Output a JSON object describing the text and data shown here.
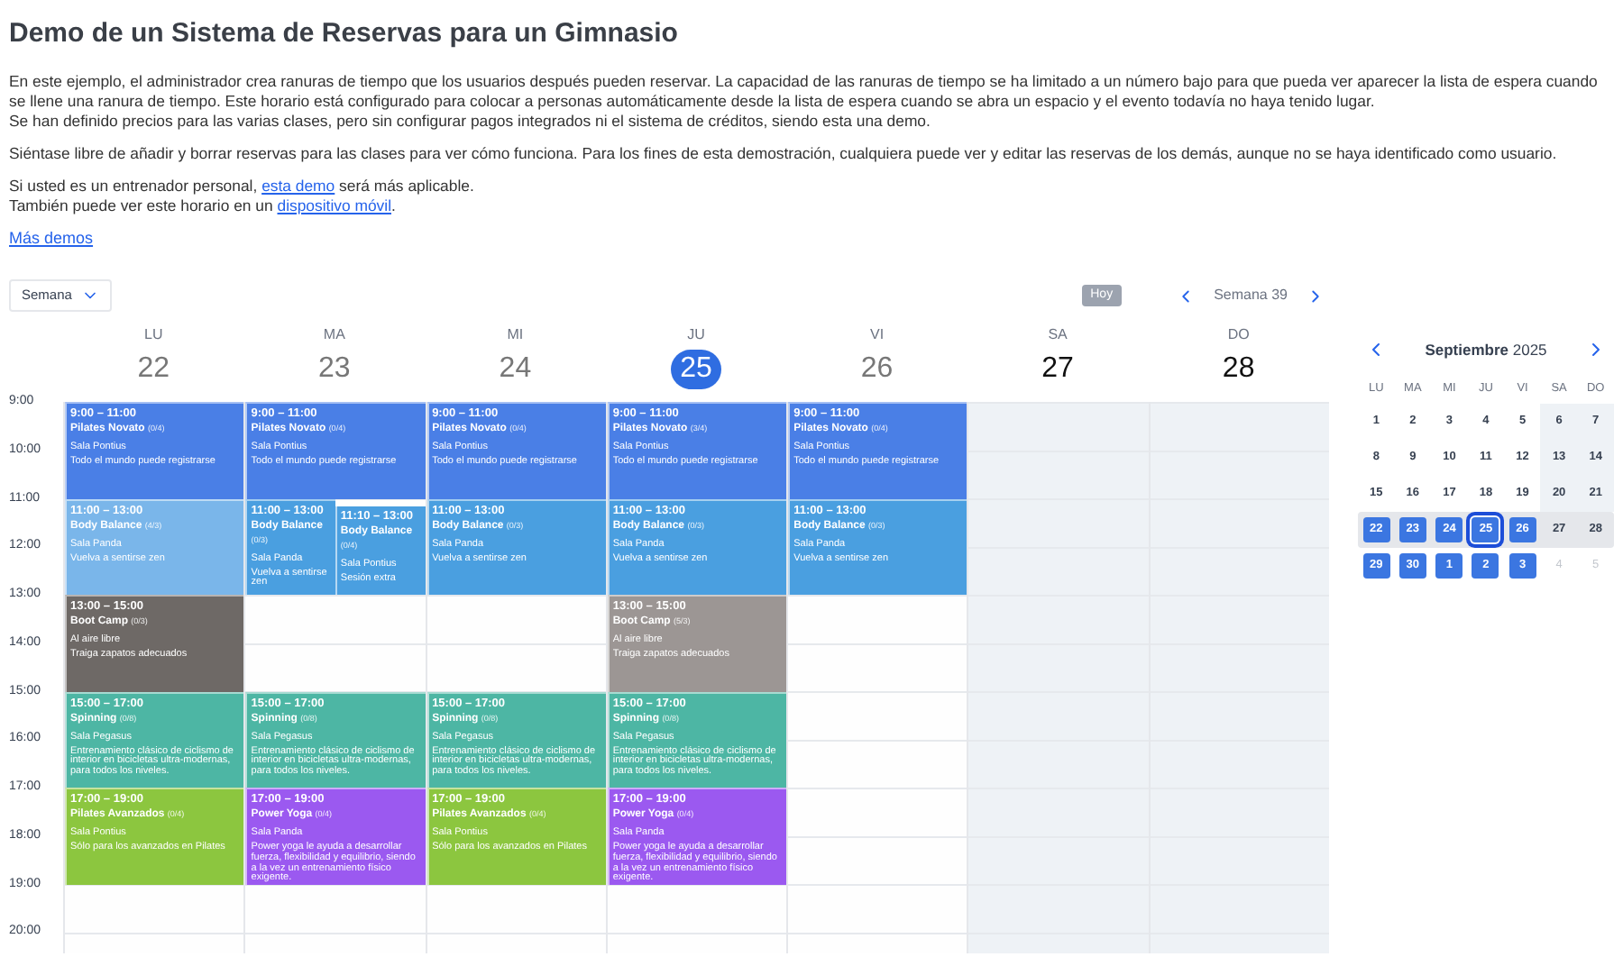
{
  "title": "Demo de un Sistema de Reservas para un Gimnasio",
  "paragraphs": [
    {
      "lines": [
        [
          {
            "text": "En este ejemplo, el administrador crea ranuras de tiempo que los usuarios después pueden reservar. La capacidad de las ranuras de tiempo se ha limitado a un número bajo para que pueda ver aparecer la lista de espera cuando se llene una ranura de tiempo. Este horario está configurado para colocar a personas automáticamente desde la lista de espera cuando se abra un espacio y el evento todavía no haya tenido lugar."
          }
        ],
        [
          {
            "text": "Se han definido precios para las varias clases, pero sin configurar pagos integrados ni el sistema de créditos, siendo esta una demo."
          }
        ]
      ]
    },
    {
      "lines": [
        [
          {
            "text": "Siéntase libre de añadir y borrar reservas para las clases para ver cómo funciona. Para los fines de esta demostración, cualquiera puede ver y editar las reservas de los demás, aunque no se haya identificado como usuario."
          }
        ]
      ]
    },
    {
      "lines": [
        [
          {
            "text": "Si usted es un entrenador personal, "
          },
          {
            "text": "esta demo",
            "kind": "link"
          },
          {
            "text": " será más aplicable."
          }
        ],
        [
          {
            "text": "También puede ver este horario en un "
          },
          {
            "text": "dispositivo móvil",
            "kind": "link"
          },
          {
            "text": "."
          }
        ]
      ]
    }
  ],
  "more_link": "Más demos",
  "toolbar": {
    "view_select": "Semana",
    "today_button": "Hoy",
    "week_label": "Semana 39"
  },
  "hours": [
    "9:00",
    "10:00",
    "11:00",
    "12:00",
    "13:00",
    "14:00",
    "15:00",
    "16:00",
    "17:00",
    "18:00",
    "19:00",
    "20:00"
  ],
  "days": [
    {
      "weekday": "LU",
      "date": "22",
      "selected": false,
      "weekend": false,
      "events": [
        {
          "time": "9:00 – 11:00",
          "title": "Pilates Novato",
          "count": "(0/4)",
          "room": "Sala Pontius",
          "description": "Todo el mundo puede registrarse",
          "color": "#4a7fe6"
        },
        {
          "time": "11:00 – 13:00",
          "title": "Body Balance",
          "count": "(4/3)",
          "room": "Sala Panda",
          "description": "Vuelva a sentirse zen",
          "color": "#7ab6ea"
        },
        {
          "time": "13:00 – 15:00",
          "title": "Boot Camp",
          "count": "(0/3)",
          "room": "Al aire libre",
          "description": "Traiga zapatos adecuados",
          "color": "#6e6966"
        },
        {
          "time": "15:00 – 17:00",
          "title": "Spinning",
          "count": "(0/8)",
          "room": "Sala Pegasus",
          "description": "Entrenamiento clásico de ciclismo de interior en bicicletas ultra-modernas, para todos los niveles.",
          "color": "#4db6a4"
        },
        {
          "time": "17:00 – 19:00",
          "title": "Pilates Avanzados",
          "count": "(0/4)",
          "room": "Sala Pontius",
          "description": "Sólo para los avanzados en Pilates",
          "color": "#8cc63f"
        }
      ]
    },
    {
      "weekday": "MA",
      "date": "23",
      "selected": false,
      "weekend": false,
      "events": [
        {
          "time": "9:00 – 11:00",
          "title": "Pilates Novato",
          "count": "(0/4)",
          "room": "Sala Pontius",
          "description": "Todo el mundo puede registrarse",
          "color": "#4a7fe6"
        },
        {
          "time": "11:00 – 13:00",
          "title": "Body Balance",
          "count": "(0/3)",
          "room": "Sala Panda",
          "description": "Vuelva a sentirse zen",
          "color": "#4a9fe0"
        },
        {
          "time": "11:10 – 13:00",
          "title": "Body Balance",
          "count": "(0/4)",
          "room": "Sala Pontius",
          "description": "Sesión extra",
          "color": "#4a9fe0"
        },
        {
          "time": "15:00 – 17:00",
          "title": "Spinning",
          "count": "(0/8)",
          "room": "Sala Pegasus",
          "description": "Entrenamiento clásico de ciclismo de interior en bicicletas ultra-modernas, para todos los niveles.",
          "color": "#4db6a4"
        },
        {
          "time": "17:00 – 19:00",
          "title": "Power Yoga",
          "count": "(0/4)",
          "room": "Sala Panda",
          "description": "Power yoga le ayuda a desarrollar fuerza, flexibilidad y equilibrio, siendo a la vez un entrenamiento físico exigente.",
          "color": "#9b59f0"
        }
      ]
    },
    {
      "weekday": "MI",
      "date": "24",
      "selected": false,
      "weekend": false,
      "events": [
        {
          "time": "9:00 – 11:00",
          "title": "Pilates Novato",
          "count": "(0/4)",
          "room": "Sala Pontius",
          "description": "Todo el mundo puede registrarse",
          "color": "#4a7fe6"
        },
        {
          "time": "11:00 – 13:00",
          "title": "Body Balance",
          "count": "(0/3)",
          "room": "Sala Panda",
          "description": "Vuelva a sentirse zen",
          "color": "#4a9fe0"
        },
        {
          "time": "15:00 – 17:00",
          "title": "Spinning",
          "count": "(0/8)",
          "room": "Sala Pegasus",
          "description": "Entrenamiento clásico de ciclismo de interior en bicicletas ultra-modernas, para todos los niveles.",
          "color": "#4db6a4"
        },
        {
          "time": "17:00 – 19:00",
          "title": "Pilates Avanzados",
          "count": "(0/4)",
          "room": "Sala Pontius",
          "description": "Sólo para los avanzados en Pilates",
          "color": "#8cc63f"
        }
      ]
    },
    {
      "weekday": "JU",
      "date": "25",
      "selected": true,
      "weekend": false,
      "events": [
        {
          "time": "9:00 – 11:00",
          "title": "Pilates Novato",
          "count": "(3/4)",
          "room": "Sala Pontius",
          "description": "Todo el mundo puede registrarse",
          "color": "#4a7fe6"
        },
        {
          "time": "11:00 – 13:00",
          "title": "Body Balance",
          "count": "(0/3)",
          "room": "Sala Panda",
          "description": "Vuelva a sentirse zen",
          "color": "#4a9fe0"
        },
        {
          "time": "13:00 – 15:00",
          "title": "Boot Camp",
          "count": "(5/3)",
          "room": "Al aire libre",
          "description": "Traiga zapatos adecuados",
          "color": "#9c9694"
        },
        {
          "time": "15:00 – 17:00",
          "title": "Spinning",
          "count": "(0/8)",
          "room": "Sala Pegasus",
          "description": "Entrenamiento clásico de ciclismo de interior en bicicletas ultra-modernas, para todos los niveles.",
          "color": "#4db6a4"
        },
        {
          "time": "17:00 – 19:00",
          "title": "Power Yoga",
          "count": "(0/4)",
          "room": "Sala Panda",
          "description": "Power yoga le ayuda a desarrollar fuerza, flexibilidad y equilibrio, siendo a la vez un entrenamiento físico exigente.",
          "color": "#9b59f0"
        }
      ]
    },
    {
      "weekday": "VI",
      "date": "26",
      "selected": false,
      "weekend": false,
      "events": [
        {
          "time": "9:00 – 11:00",
          "title": "Pilates Novato",
          "count": "(0/4)",
          "room": "Sala Pontius",
          "description": "Todo el mundo puede registrarse",
          "color": "#4a7fe6"
        },
        {
          "time": "11:00 – 13:00",
          "title": "Body Balance",
          "count": "(0/3)",
          "room": "Sala Panda",
          "description": "Vuelva a sentirse zen",
          "color": "#4a9fe0"
        }
      ]
    },
    {
      "weekday": "SA",
      "date": "27",
      "selected": false,
      "weekend": true
    },
    {
      "weekday": "DO",
      "date": "28",
      "selected": false,
      "weekend": true
    }
  ],
  "mini_calendar": {
    "month": "Septiembre",
    "year": "2025",
    "weekdays": [
      "LU",
      "MA",
      "MI",
      "JU",
      "VI",
      "SA",
      "DO"
    ],
    "weeks": [
      {
        "selected": false,
        "days": [
          {
            "label": "1",
            "selected": false,
            "today": false,
            "muted": false
          },
          {
            "label": "2",
            "selected": false,
            "today": false,
            "muted": false
          },
          {
            "label": "3",
            "selected": false,
            "today": false,
            "muted": false
          },
          {
            "label": "4",
            "selected": false,
            "today": false,
            "muted": false
          },
          {
            "label": "5",
            "selected": false,
            "today": false,
            "muted": false
          },
          {
            "label": "6",
            "selected": false,
            "today": false,
            "muted": false
          },
          {
            "label": "7",
            "selected": false,
            "today": false,
            "muted": false
          }
        ]
      },
      {
        "selected": false,
        "days": [
          {
            "label": "8",
            "selected": false,
            "today": false,
            "muted": false
          },
          {
            "label": "9",
            "selected": false,
            "today": false,
            "muted": false
          },
          {
            "label": "10",
            "selected": false,
            "today": false,
            "muted": false
          },
          {
            "label": "11",
            "selected": false,
            "today": false,
            "muted": false
          },
          {
            "label": "12",
            "selected": false,
            "today": false,
            "muted": false
          },
          {
            "label": "13",
            "selected": false,
            "today": false,
            "muted": false
          },
          {
            "label": "14",
            "selected": false,
            "today": false,
            "muted": false
          }
        ]
      },
      {
        "selected": false,
        "days": [
          {
            "label": "15",
            "selected": false,
            "today": false,
            "muted": false
          },
          {
            "label": "16",
            "selected": false,
            "today": false,
            "muted": false
          },
          {
            "label": "17",
            "selected": false,
            "today": false,
            "muted": false
          },
          {
            "label": "18",
            "selected": false,
            "today": false,
            "muted": false
          },
          {
            "label": "19",
            "selected": false,
            "today": false,
            "muted": false
          },
          {
            "label": "20",
            "selected": false,
            "today": false,
            "muted": false
          },
          {
            "label": "21",
            "selected": false,
            "today": false,
            "muted": false
          }
        ]
      },
      {
        "selected": true,
        "days": [
          {
            "label": "22",
            "selected": true,
            "today": false,
            "muted": false
          },
          {
            "label": "23",
            "selected": true,
            "today": false,
            "muted": false
          },
          {
            "label": "24",
            "selected": true,
            "today": false,
            "muted": false
          },
          {
            "label": "25",
            "selected": true,
            "today": true,
            "muted": false
          },
          {
            "label": "26",
            "selected": true,
            "today": false,
            "muted": false
          },
          {
            "label": "27",
            "selected": false,
            "today": false,
            "muted": false
          },
          {
            "label": "28",
            "selected": false,
            "today": false,
            "muted": false
          }
        ]
      },
      {
        "selected": false,
        "days": [
          {
            "label": "29",
            "selected": true,
            "today": false,
            "muted": false
          },
          {
            "label": "30",
            "selected": true,
            "today": false,
            "muted": false
          },
          {
            "label": "1",
            "selected": true,
            "today": false,
            "muted": false
          },
          {
            "label": "2",
            "selected": true,
            "today": false,
            "muted": false
          },
          {
            "label": "3",
            "selected": true,
            "today": false,
            "muted": false
          },
          {
            "label": "4",
            "selected": false,
            "today": false,
            "muted": true
          },
          {
            "label": "5",
            "selected": false,
            "today": false,
            "muted": true
          }
        ]
      }
    ]
  }
}
